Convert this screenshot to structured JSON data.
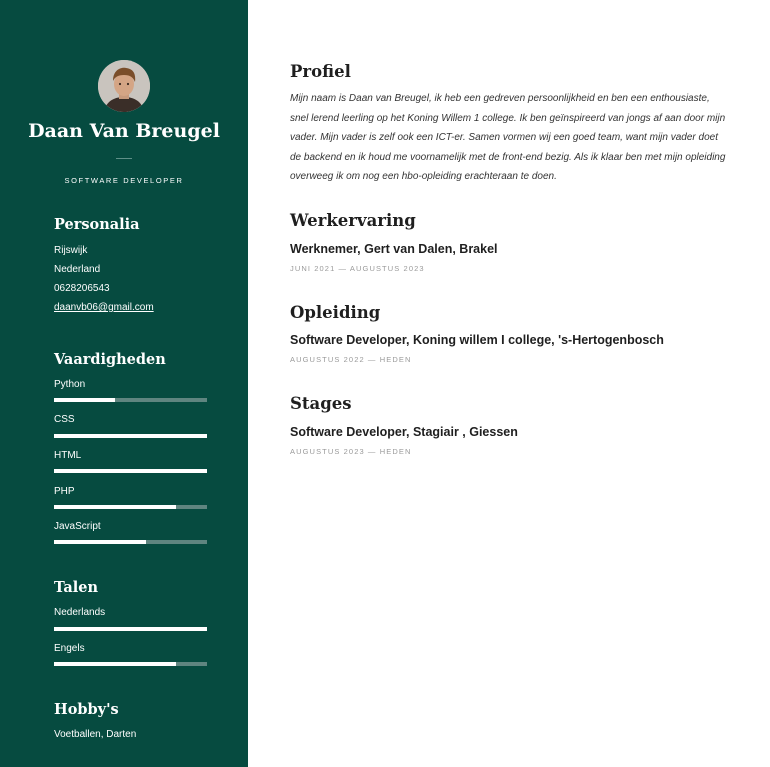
{
  "profile": {
    "name": "Daan Van Breugel",
    "role": "SOFTWARE DEVELOPER",
    "avatar_icon": "person-photo"
  },
  "personalia": {
    "heading": "Personalia",
    "city": "Rijswijk",
    "country": "Nederland",
    "phone": "0628206543",
    "email": "daanvb06@gmail.com"
  },
  "skills": {
    "heading": "Vaardigheden",
    "items": [
      {
        "label": "Python",
        "level": 0.4
      },
      {
        "label": "CSS",
        "level": 1.0
      },
      {
        "label": "HTML",
        "level": 1.0
      },
      {
        "label": "PHP",
        "level": 0.8
      },
      {
        "label": "JavaScript",
        "level": 0.6
      }
    ]
  },
  "languages": {
    "heading": "Talen",
    "items": [
      {
        "label": "Nederlands",
        "level": 1.0
      },
      {
        "label": "Engels",
        "level": 0.8
      }
    ]
  },
  "hobbies": {
    "heading": "Hobby's",
    "text": "Voetballen, Darten"
  },
  "main": {
    "profile_heading": "Profiel",
    "profile_text": "Mijn naam is Daan van Breugel, ik heb een gedreven persoonlijkheid en ben een enthousiaste, snel lerend leerling op het Koning Willem 1 college. Ik ben geïnspireerd van jongs af aan door mijn vader. Mijn vader is zelf ook een ICT-er. Samen vormen wij een goed team, want mijn vader doet de backend en ik houd me voornamelijk met de front-end bezig. Als ik klaar ben met mijn opleiding overweeg ik om nog een hbo-opleiding erachteraan te doen.",
    "work": {
      "heading": "Werkervaring",
      "title": "Werknemer, Gert van Dalen, Brakel",
      "date": "JUNI 2021 — AUGUSTUS 2023"
    },
    "education": {
      "heading": "Opleiding",
      "title": "Software Developer, Koning willem I college, 's-Hertogenbosch",
      "date": "AUGUSTUS 2022 — HEDEN"
    },
    "internships": {
      "heading": "Stages",
      "title": "Software Developer, Stagiair , Giessen",
      "date": "AUGUSTUS 2023 — HEDEN"
    }
  },
  "colors": {
    "sidebar": "#064b40",
    "bar_track": "#5f8580",
    "bar_fill": "#ffffff"
  }
}
